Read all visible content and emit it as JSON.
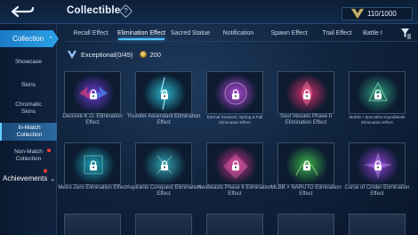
{
  "header": {
    "title": "Collectible",
    "info_symbol": "?",
    "progress_text": "110/1000"
  },
  "tabs": [
    {
      "label": "Recall Effect"
    },
    {
      "label": "Elimination Effect"
    },
    {
      "label": "Sacred Statue"
    },
    {
      "label": "Notification"
    },
    {
      "label": "Spawn Effect"
    },
    {
      "label": "Trail Effect"
    },
    {
      "label": "Battle I"
    }
  ],
  "sidebar": {
    "collection_label": "Collection",
    "items": [
      {
        "label": "Showcase"
      },
      {
        "label": "Skins"
      },
      {
        "label": "Chromatic Skins"
      },
      {
        "label": "In-Match Collection"
      },
      {
        "label": "Non-Match Collection"
      }
    ],
    "achievements_label": "Achievements"
  },
  "section": {
    "label": "Exceptional(0/45)",
    "cost": "200"
  },
  "cards": [
    {
      "name": "Decisive K.O. Elimination Effect",
      "small": false
    },
    {
      "name": "Thunder Ascendant Elimination Effect",
      "small": false
    },
    {
      "name": "Eternal Seasons: Spring & Fall Elimination Effect",
      "small": true
    },
    {
      "name": "Soul Vessels Phase II Elimination Effect",
      "small": false
    },
    {
      "name": "Mobile • Specialist Squadlands Elimination Effect",
      "small": true
    },
    {
      "name": "Metro Zero Elimination Effect",
      "small": false
    },
    {
      "name": "Aspirants Conquest Elimination Effect",
      "small": false
    },
    {
      "name": "Neobeasts Phase II Elimination Effect",
      "small": false
    },
    {
      "name": "MLBB × NARUTO Elimination Effect",
      "small": false
    },
    {
      "name": "Curse of Cinder Elimination Effect",
      "small": false
    }
  ],
  "colors": {
    "accent": "#4fc3ff",
    "sidebar_active": "#1b7bc6",
    "badge": "#ff3b3b"
  }
}
